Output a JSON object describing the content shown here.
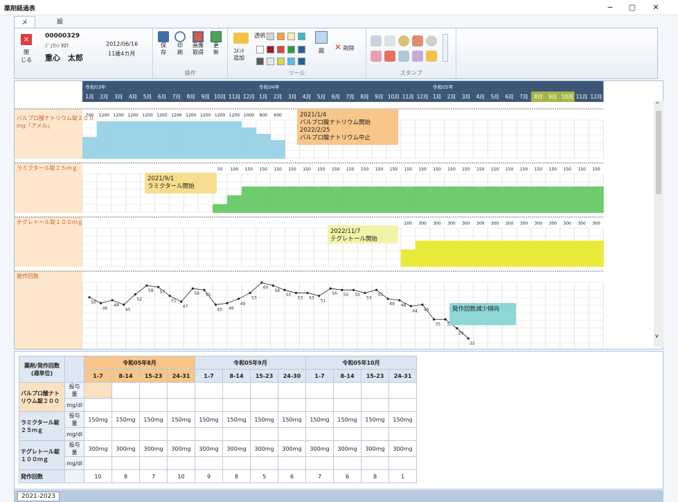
{
  "window": {
    "title": "薬剤経過表",
    "minimize": "−",
    "restore": "▢",
    "close": "✕"
  },
  "tabs": [
    "メニュー",
    "設定"
  ],
  "ribbon": {
    "close_label_top": "閉",
    "close_label_bottom": "じる",
    "patient_id": "00000329",
    "patient_kana": "ｼﾞｭｳｼﾝ ﾀﾛｳ",
    "patient_name": "重心　太郎",
    "birth_date": "2012/06/16",
    "age": "11歳4カ月",
    "ops": [
      {
        "a": "保",
        "b": "存"
      },
      {
        "a": "印",
        "b": "刷"
      },
      {
        "a": "画像",
        "b": "取得"
      },
      {
        "a": "更",
        "b": "新"
      }
    ],
    "ops_group": "操作",
    "tool_labels": {
      "transparent": "透明",
      "comment_a": "ｺﾒﾝﾄ",
      "comment_b": "追加",
      "figure": "図",
      "delete": "削除"
    },
    "tool_group": "ツール",
    "stamp_group": "スタンプ",
    "colors": {
      "c1": "#d4d4d4",
      "c2": "#f2a23a",
      "c3": "#f7efad",
      "c4": "#3fb9c3",
      "c5": "#ffffff",
      "c6": "#a2162c",
      "c7": "#e0443f",
      "c8": "#2e9a45",
      "c9": "#2f5aa3",
      "c10": "#5b5b5b",
      "c11": "#e8e8e8",
      "c12": "#d9d64a",
      "c13": "#4fc1e8",
      "c14": "#3ea07a",
      "c15": "#1d63a0"
    }
  },
  "chart_data": {
    "type": "table",
    "eras": [
      "令和03年",
      "令和04年",
      "令和05年"
    ],
    "months": [
      "1月",
      "2月",
      "3月",
      "4月",
      "5月",
      "6月",
      "7月",
      "8月",
      "9月",
      "10月",
      "11月",
      "12月",
      "1月",
      "2月",
      "3月",
      "4月",
      "5月",
      "6月",
      "7月",
      "8月",
      "9月",
      "10月",
      "11月",
      "12月",
      "1月",
      "2月",
      "3月",
      "4月",
      "5月",
      "6月",
      "7月",
      "8月",
      "9月",
      "10月",
      "11月",
      "12月"
    ],
    "highlight_months": [
      31,
      32,
      33
    ],
    "rows": [
      {
        "label": "バルプロ酸ナトリウム錠２００mg「アメル」",
        "color": "#9dd3e6",
        "values": [
          700,
          1200,
          1200,
          1200,
          1200,
          1200,
          1200,
          1200,
          1200,
          1200,
          1200,
          1000,
          800,
          600
        ],
        "start": 0,
        "note": [
          "2021/1/4",
          "バルプロ酸ナトリウム開始",
          "2022/2/25",
          "バルプロ酸ナトリウム中止"
        ],
        "note_color": "#f8c58a"
      },
      {
        "label": "ラミクタール錠２５ｍｇ",
        "color": "#6ecb6e",
        "values": [
          50,
          100,
          150,
          150,
          150,
          150,
          150,
          150,
          150,
          150,
          150,
          150,
          150,
          150,
          150,
          150,
          150,
          150,
          150,
          150,
          150,
          150,
          150,
          150,
          150,
          150,
          150
        ],
        "start": 9,
        "note": [
          "2021/9/1",
          "ラミクタール開始"
        ],
        "note_color": "#f7de8e"
      },
      {
        "label": "テグレトール錠１００ｍｇ",
        "color": "#eaea3c",
        "values": [
          200,
          300,
          300,
          300,
          300,
          300,
          300,
          300,
          300,
          300,
          300,
          300,
          300,
          300
        ],
        "start": 22,
        "note": [
          "2022/11/7",
          "テグレトール開始"
        ],
        "note_color": "#f2f2a8"
      },
      {
        "label": "発作回数",
        "seizure": [
          50,
          46,
          48,
          45,
          52,
          58,
          57,
          51,
          47,
          56,
          55,
          45,
          46,
          49,
          53,
          60,
          58,
          55,
          53,
          53,
          51,
          56,
          55,
          55,
          53,
          55,
          49,
          48,
          44,
          45,
          35,
          35,
          29,
          22
        ],
        "note": [
          "発作回数減少傾向"
        ],
        "note_color": "#8fd6d6"
      }
    ]
  },
  "table": {
    "corner_a": "薬剤/発作回数",
    "corner_b": "(週単位)",
    "months": [
      "令和05年8月",
      "令和05年9月",
      "令和05年10月"
    ],
    "weeks": [
      [
        "1-7",
        "8-14",
        "15-23",
        "24-31"
      ],
      [
        "1-7",
        "8-14",
        "15-23",
        "24-30"
      ],
      [
        "1-7",
        "8-14",
        "15-23",
        "24-31"
      ]
    ],
    "drug1_a": "バルプロ酸ナト",
    "drug1_b": "リウム錠２００",
    "drug2_a": "ラミクタール錠",
    "drug2_b": "２５ｍｇ",
    "drug3_a": "テグレトール錠",
    "drug3_b": "１００ｍｇ",
    "dose_label": "投与量",
    "mg_label": "mg/dl",
    "seizure_label": "発作回数",
    "drug2_doses": [
      "150mg",
      "150mg",
      "150mg",
      "150mg",
      "150mg",
      "150mg",
      "150mg",
      "150mg",
      "150mg",
      "150mg",
      "150mg",
      "150mg"
    ],
    "drug3_doses": [
      "300mg",
      "300mg",
      "300mg",
      "300mg",
      "300mg",
      "300mg",
      "300mg",
      "300mg",
      "300mg",
      "300mg",
      "300mg",
      "300mg"
    ],
    "seizures": [
      "10",
      "8",
      "7",
      "10",
      "9",
      "8",
      "5",
      "6",
      "7",
      "6",
      "8",
      "1"
    ]
  },
  "sheet_tab": "2021-2023"
}
